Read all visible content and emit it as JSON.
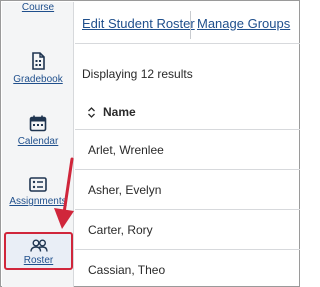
{
  "sidebar": {
    "items": [
      {
        "label": "Course",
        "icon": "course-icon"
      },
      {
        "label": "Gradebook",
        "icon": "gradebook-icon"
      },
      {
        "label": "Calendar",
        "icon": "calendar-icon"
      },
      {
        "label": "Assignments",
        "icon": "assignments-icon"
      },
      {
        "label": "Roster",
        "icon": "roster-icon",
        "selected": true
      }
    ]
  },
  "tabs": [
    {
      "label": "Edit Student Roster"
    },
    {
      "label": "Manage Groups"
    }
  ],
  "results_text": "Displaying 12 results",
  "table": {
    "column_header": "Name",
    "rows": [
      "Arlet, Wrenlee",
      "Asher, Evelyn",
      "Carter, Rory",
      "Cassian, Theo"
    ]
  },
  "colors": {
    "link": "#1f4f8c",
    "highlight_border": "#d0263b",
    "annotation_arrow": "#d0263b",
    "sidebar_bg": "#f4f5f6"
  }
}
